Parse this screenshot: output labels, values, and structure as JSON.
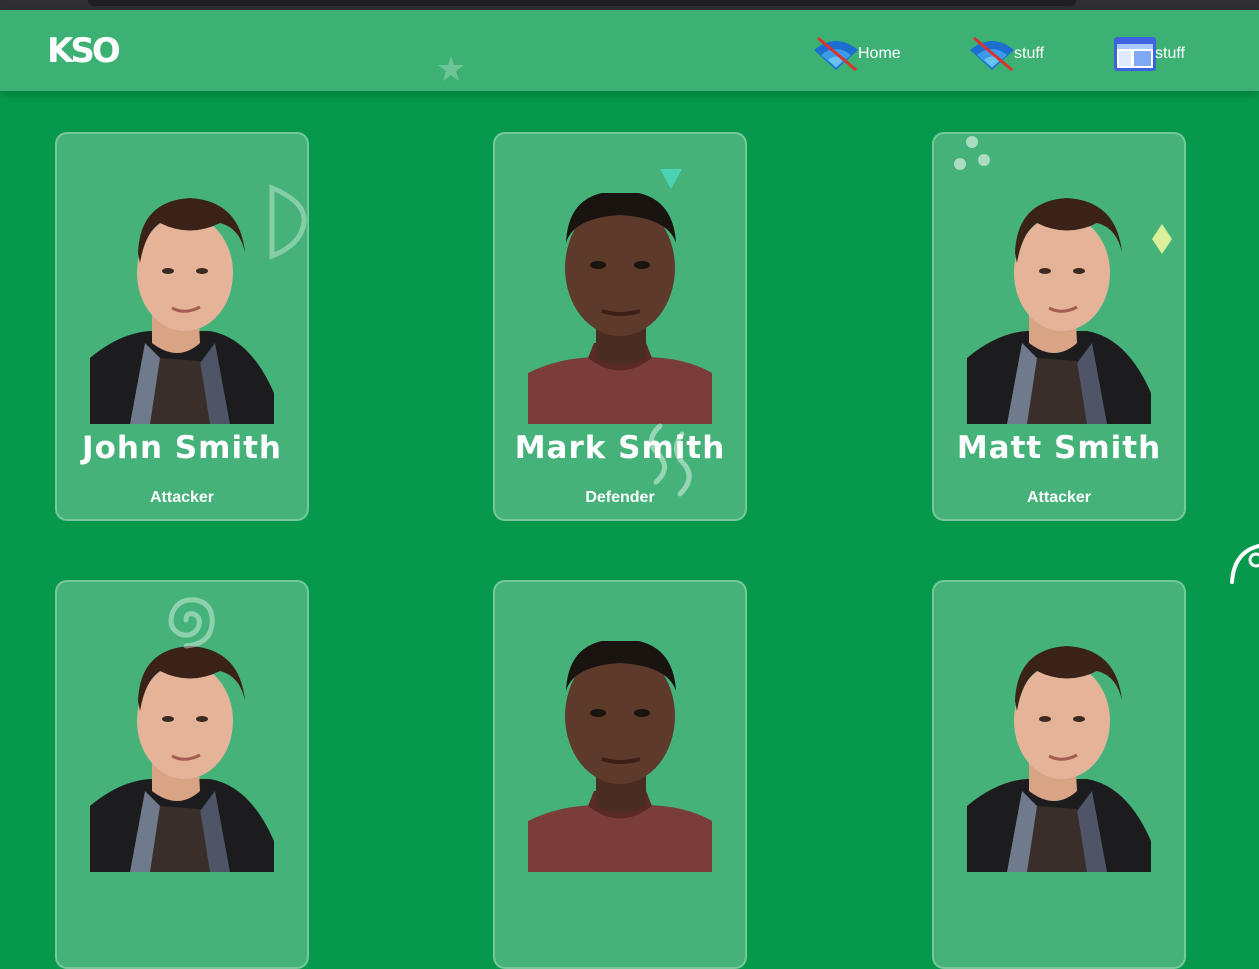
{
  "brand": {
    "logo_text": "KSO"
  },
  "nav": {
    "items": [
      {
        "label": "Home",
        "icon": "wifi-off-icon"
      },
      {
        "label": "stuff",
        "icon": "wifi-off-icon"
      },
      {
        "label": "stuff",
        "icon": "window-icon"
      }
    ]
  },
  "players": [
    {
      "name": "John Smith",
      "role": "Attacker"
    },
    {
      "name": "Mark Smith",
      "role": "Defender"
    },
    {
      "name": "Matt Smith",
      "role": "Attacker"
    },
    {
      "name": "",
      "role": ""
    },
    {
      "name": "",
      "role": ""
    },
    {
      "name": "",
      "role": ""
    }
  ],
  "colors": {
    "background": "#06994c",
    "navbar": "#3db174",
    "card": "rgba(255,255,255,0.25)",
    "text": "#ffffff"
  }
}
